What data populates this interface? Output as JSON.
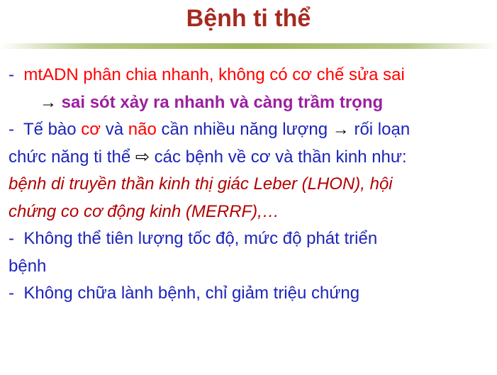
{
  "slide": {
    "title": "Bệnh ti thể",
    "accent_colors": {
      "title": "#A52A1F",
      "body": "#1C24BA",
      "highlight_red": "#FF0000",
      "highlight_purple": "#9B1FA0",
      "italic_red": "#B20000",
      "divider": "#9DB55D"
    }
  },
  "bullets": {
    "b1": {
      "dash": "-",
      "text": "mtADN phân chia nhanh, không có cơ chế sửa sai",
      "arrow": "→",
      "conclusion": "sai sót xảy ra nhanh và càng trầm trọng"
    },
    "b2": {
      "dash": "-",
      "p1": "Tế bào",
      "w1": "cơ",
      "p2": "và",
      "w2": "não",
      "p3": "cần nhiều năng lượng",
      "arrow": "→",
      "p4": "rối loạn",
      "line2_a": "chức năng ti thể",
      "arrow2": "⇨",
      "line2_b": "các bệnh về cơ và thần kinh như:",
      "italic1": "bệnh di truyền thần kinh thị giác Leber (LHON), hội",
      "italic2": "chứng co cơ động kinh (MERRF),…"
    },
    "b3": {
      "dash": "-",
      "text1": "Không thể tiên lượng tốc độ, mức độ phát triển",
      "text2": "bệnh"
    },
    "b4": {
      "dash": "-",
      "text": "Không chữa lành bệnh, chỉ giảm triệu chứng"
    }
  }
}
